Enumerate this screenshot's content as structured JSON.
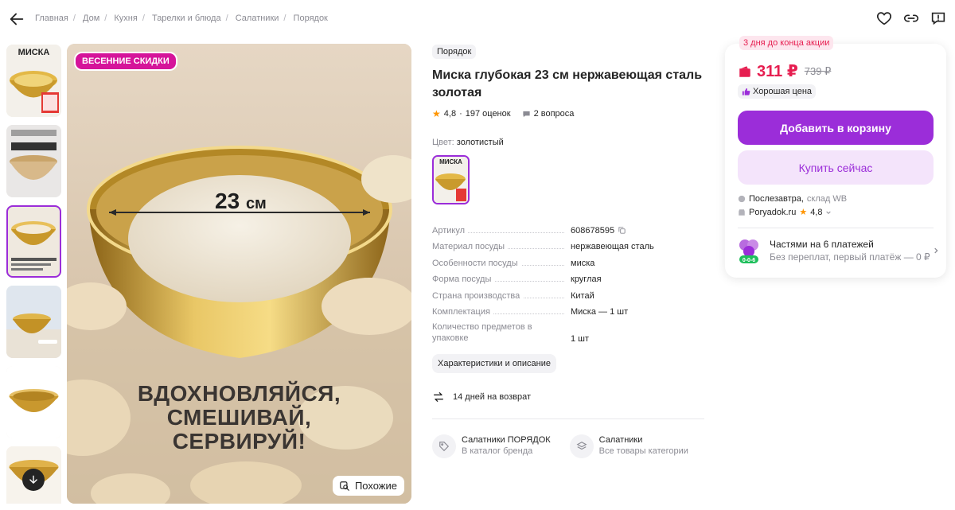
{
  "breadcrumbs": [
    "Главная",
    "Дом",
    "Кухня",
    "Тарелки и блюда",
    "Салатники",
    "Порядок"
  ],
  "icons": {
    "back": "arrow-left-icon",
    "favorite": "heart-icon",
    "share": "link-icon",
    "report": "report-icon",
    "scroll_down": "arrow-down-icon",
    "similar": "image-search-icon"
  },
  "gallery": {
    "thumb1_brand": "МИСКА",
    "promo_badge": "ВЕСЕННИЕ СКИДКИ",
    "size_value": "23",
    "size_unit": "см",
    "slogan_line1": "ВДОХНОВЛЯЙСЯ,",
    "slogan_line2": "СМЕШИВАЙ,",
    "slogan_line3": "СЕРВИРУЙ!",
    "similar_label": "Похожие"
  },
  "product": {
    "brand": "Порядок",
    "title": "Миска глубокая 23 см нержавеющая сталь золотая",
    "rating": "4,8",
    "reviews": "197 оценок",
    "questions": "2 вопроса",
    "color_label": "Цвет:",
    "color_value": "золотистый",
    "swatch_label": "МИСКА",
    "specs": [
      {
        "k": "Артикул",
        "v": "608678595"
      },
      {
        "k": "Материал посуды",
        "v": "нержавеющая сталь"
      },
      {
        "k": "Особенности посуды",
        "v": "миска"
      },
      {
        "k": "Форма посуды",
        "v": "круглая"
      },
      {
        "k": "Страна производства",
        "v": "Китай"
      },
      {
        "k": "Комплектация",
        "v": "Миска — 1 шт"
      },
      {
        "k": "Количество предметов в упаковке",
        "v": "1 шт"
      }
    ],
    "chars_button": "Характеристики и описание",
    "return_text": "14 дней на возврат",
    "brand_link": {
      "title": "Салатники ПОРЯДОК",
      "subtitle": "В каталог бренда"
    },
    "category_link": {
      "title": "Салатники",
      "subtitle": "Все товары категории"
    }
  },
  "purchase": {
    "timer": "3 дня до конца акции",
    "price": "311 ₽",
    "old_price": "739 ₽",
    "good_price": "Хорошая цена",
    "add_to_cart": "Добавить в корзину",
    "buy_now": "Купить сейчас",
    "delivery_day": "Послезавтра,",
    "delivery_stock": "склад WB",
    "seller": "Poryadok.ru",
    "seller_rating": "4,8",
    "split_title": "Частями на 6 платежей",
    "split_sub": "Без переплат, первый платёж — 0 ₽",
    "split_badge": "0-0-6"
  },
  "colors": {
    "accent": "#9b2dd9",
    "price": "#e61e50",
    "promo": "#d5149a"
  }
}
